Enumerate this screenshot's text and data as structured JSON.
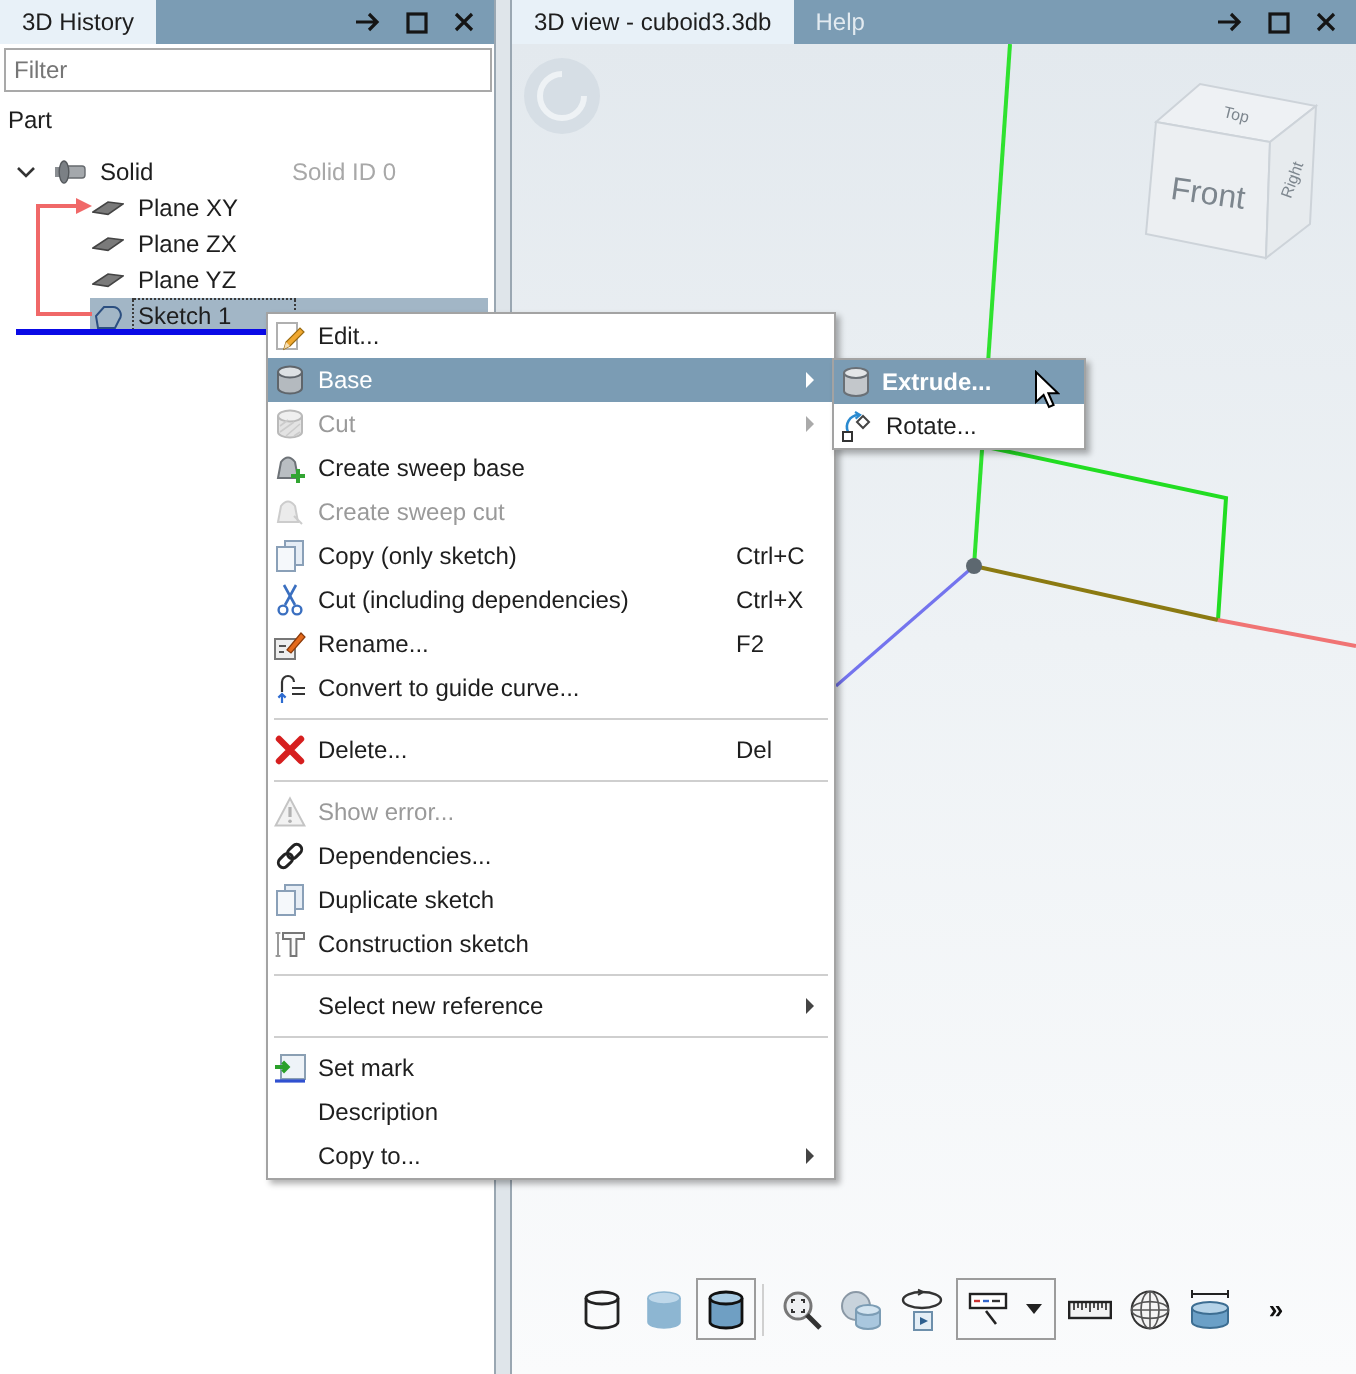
{
  "history_panel": {
    "tabs": [
      {
        "label": "3D History",
        "selected": true
      }
    ],
    "filter": {
      "placeholder": "Filter"
    },
    "section_label": "Part",
    "tree": [
      {
        "label": "Solid",
        "kind": "solid",
        "selected": false,
        "expanded": true,
        "note": "Solid ID 0",
        "children": [
          {
            "label": "Plane XY",
            "kind": "plane",
            "selected": false
          },
          {
            "label": "Plane ZX",
            "kind": "plane",
            "selected": false
          },
          {
            "label": "Plane YZ",
            "kind": "plane",
            "selected": false
          },
          {
            "label": "Sketch 1",
            "kind": "sketch",
            "selected": true
          }
        ]
      }
    ]
  },
  "view_panel": {
    "tabs": [
      {
        "label": "3D view - cuboid3.3db",
        "selected": true
      },
      {
        "label": "Help",
        "selected": false
      }
    ],
    "view_cube": {
      "top": "Top",
      "front": "Front",
      "right": "Right"
    },
    "toolbar": {
      "view_modes": [
        {
          "selected": false
        },
        {
          "selected": false
        },
        {
          "selected": true
        }
      ],
      "more": "»"
    }
  },
  "context_menu": {
    "groups": [
      {
        "items": [
          {
            "label": "Edit...",
            "selected": false,
            "disabled": false,
            "has_submenu": false
          },
          {
            "label": "Base",
            "selected": true,
            "disabled": false,
            "has_submenu": true
          },
          {
            "label": "Cut",
            "selected": false,
            "disabled": true,
            "has_submenu": true
          },
          {
            "label": "Create sweep base",
            "selected": false,
            "disabled": false,
            "has_submenu": false
          },
          {
            "label": "Create sweep cut",
            "selected": false,
            "disabled": true,
            "has_submenu": false
          },
          {
            "label": "Copy (only sketch)",
            "shortcut": "Ctrl+C",
            "selected": false,
            "disabled": false,
            "has_submenu": false
          },
          {
            "label": "Cut (including dependencies)",
            "shortcut": "Ctrl+X",
            "selected": false,
            "disabled": false,
            "has_submenu": false
          },
          {
            "label": "Rename...",
            "shortcut": "F2",
            "selected": false,
            "disabled": false,
            "has_submenu": false
          },
          {
            "label": "Convert to guide curve...",
            "selected": false,
            "disabled": false,
            "has_submenu": false
          }
        ]
      },
      {
        "items": [
          {
            "label": "Delete...",
            "shortcut": "Del",
            "selected": false,
            "disabled": false,
            "has_submenu": false
          }
        ]
      },
      {
        "items": [
          {
            "label": "Show error...",
            "selected": false,
            "disabled": true,
            "has_submenu": false
          },
          {
            "label": "Dependencies...",
            "selected": false,
            "disabled": false,
            "has_submenu": false
          },
          {
            "label": "Duplicate sketch",
            "selected": false,
            "disabled": false,
            "has_submenu": false
          },
          {
            "label": "Construction sketch",
            "selected": false,
            "disabled": false,
            "has_submenu": false
          }
        ]
      },
      {
        "items": [
          {
            "label": "Select new reference",
            "selected": false,
            "disabled": false,
            "has_submenu": true
          }
        ]
      },
      {
        "items": [
          {
            "label": "Set mark",
            "selected": false,
            "disabled": false,
            "has_submenu": false
          },
          {
            "label": "Description",
            "selected": false,
            "disabled": false,
            "has_submenu": false
          },
          {
            "label": "Copy to...",
            "selected": false,
            "disabled": false,
            "has_submenu": true
          }
        ]
      }
    ]
  },
  "submenu": {
    "items": [
      {
        "label": "Extrude...",
        "selected": true
      },
      {
        "label": "Rotate...",
        "selected": false
      }
    ]
  }
}
